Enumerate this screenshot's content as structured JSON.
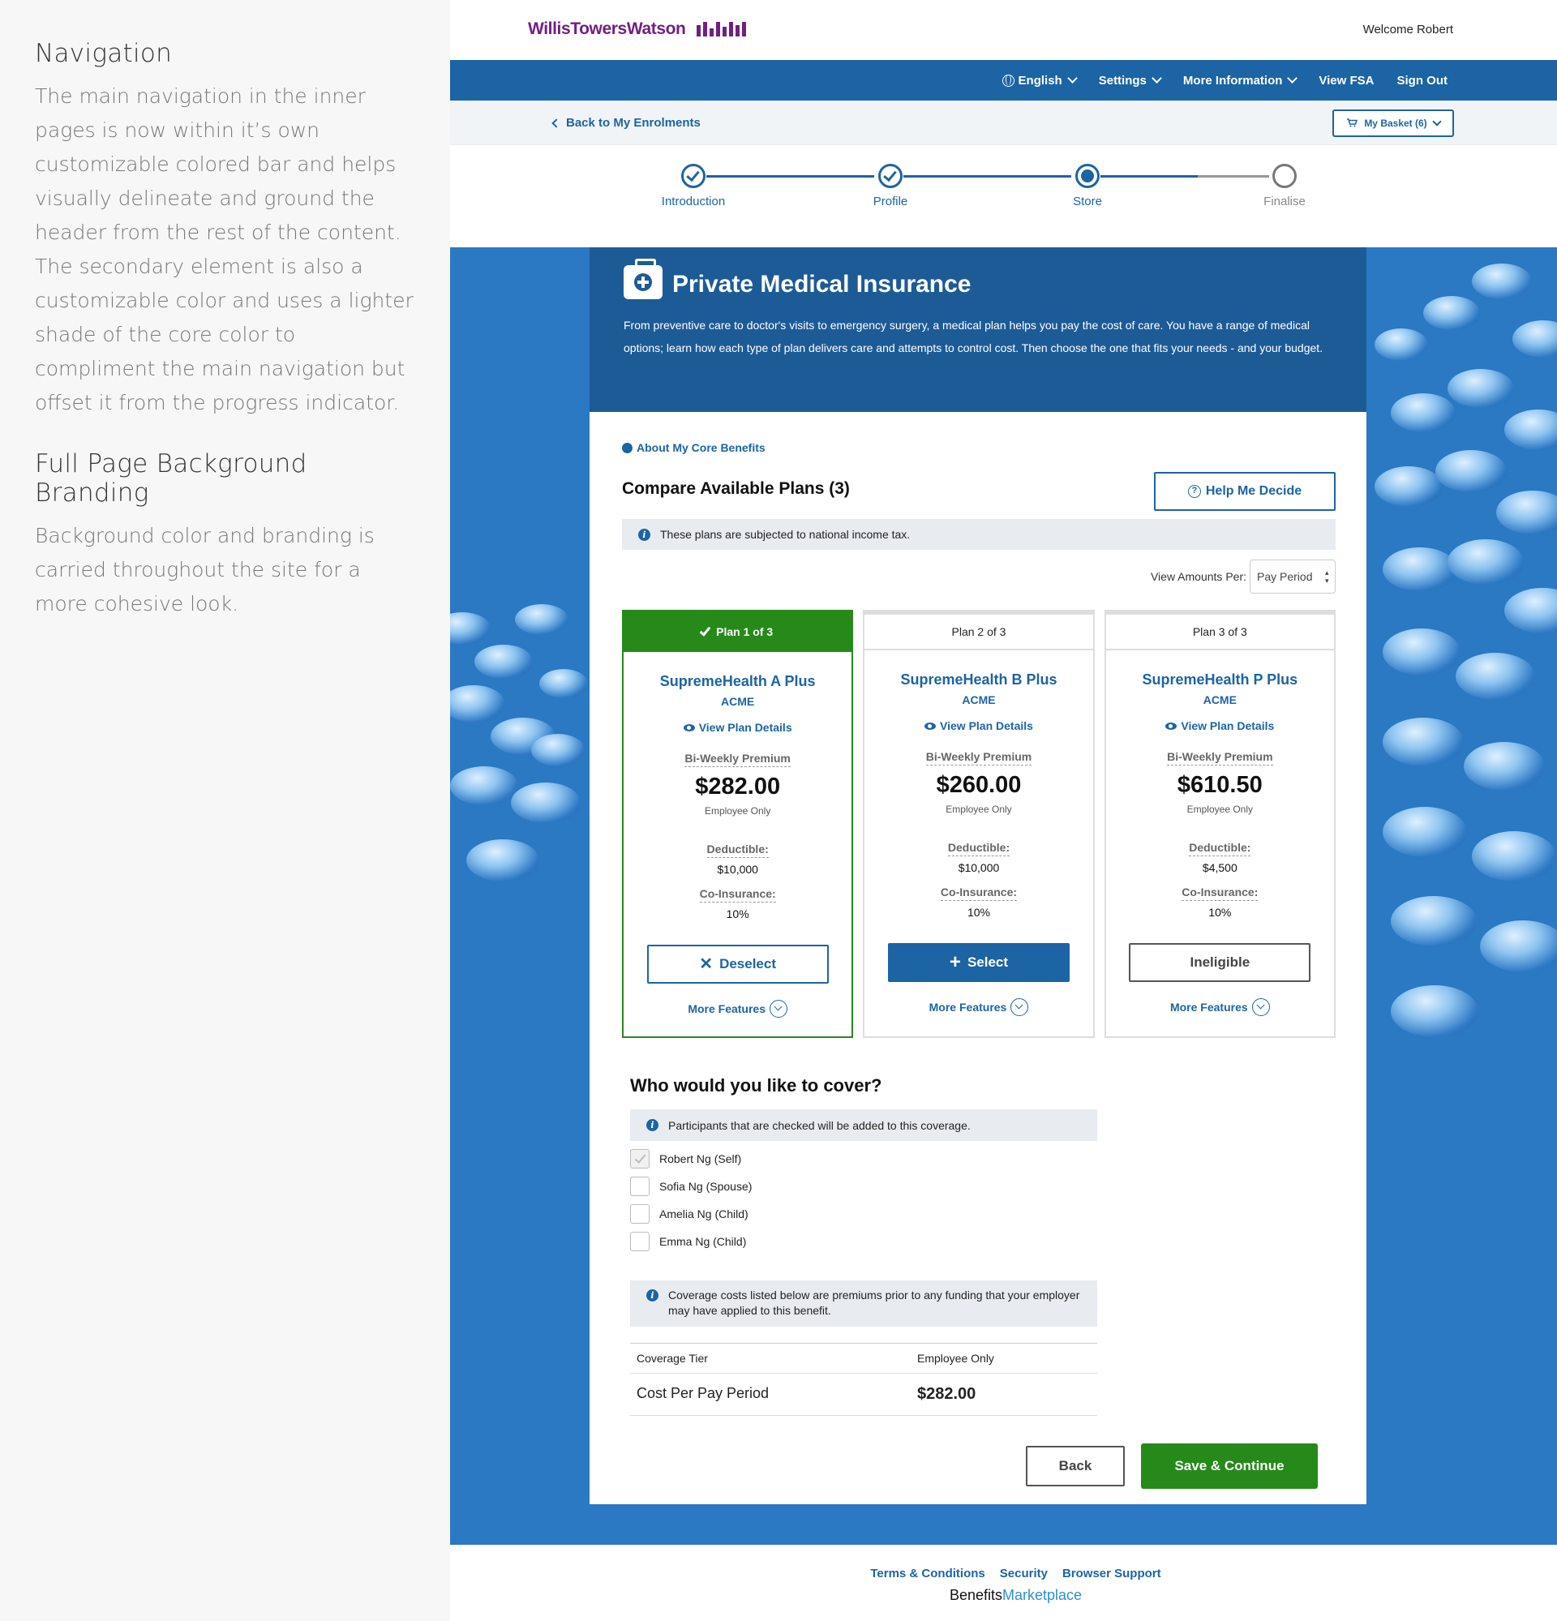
{
  "notes": [
    {
      "title": "Navigation",
      "body": "The main navigation in the inner pages is now within it’s own customizable colored bar and helps visually delineate and ground the header from the rest of the content. The secondary element is also a customizable color and uses a lighter shade of the core color to compliment the main navigation but offset it from the progress indicator."
    },
    {
      "title": "Full Page Background Branding",
      "body": "Background color and branding is carried throughout the site for a more cohesive look."
    }
  ],
  "brand": {
    "logo_text": "WillisTowersWatson",
    "primary_color": "#1c64a3",
    "logo_color": "#702082",
    "success_color": "#268a1a"
  },
  "header": {
    "welcome": "Welcome Robert"
  },
  "nav": {
    "language": "English",
    "settings": "Settings",
    "more_info": "More Information",
    "view_fsa": "View FSA",
    "sign_out": "Sign Out"
  },
  "subbar": {
    "back_link": "Back to My Enrolments",
    "basket": "My Basket (6)"
  },
  "progress": {
    "steps": [
      {
        "label": "Introduction",
        "state": "complete"
      },
      {
        "label": "Profile",
        "state": "complete"
      },
      {
        "label": "Store",
        "state": "current"
      },
      {
        "label": "Finalise",
        "state": "future"
      }
    ]
  },
  "banner": {
    "icon": "medical-kit-icon",
    "title": "Private Medical Insurance",
    "description": "From preventive care to doctor's visits to emergency surgery, a medical plan helps you pay the cost of care. You have a range of medical options; learn how each type of plan delivers care and attempts to control cost. Then choose the one that fits your needs - and your budget."
  },
  "panel": {
    "core_link": "About My Core Benefits",
    "compare_title": "Compare Available Plans (3)",
    "help_button": "Help Me Decide",
    "tax_note": "These plans are subjected to national income tax.",
    "view_amounts_label": "View Amounts Per:",
    "view_amounts_value": "Pay Period"
  },
  "plans": [
    {
      "header": "Plan 1 of 3",
      "name": "SupremeHealth A Plus",
      "carrier": "ACME",
      "details_link": "View Plan Details",
      "premium_label": "Bi-Weekly Premium",
      "premium": "$282.00",
      "coverage": "Employee Only",
      "deductible_label": "Deductible:",
      "deductible": "$10,000",
      "coinsurance_label": "Co-Insurance:",
      "coinsurance": "10%",
      "button": "Deselect",
      "more": "More Features"
    },
    {
      "header": "Plan 2 of 3",
      "name": "SupremeHealth B Plus",
      "carrier": "ACME",
      "details_link": "View Plan Details",
      "premium_label": "Bi-Weekly Premium",
      "premium": "$260.00",
      "coverage": "Employee Only",
      "deductible_label": "Deductible:",
      "deductible": "$10,000",
      "coinsurance_label": "Co-Insurance:",
      "coinsurance": "10%",
      "button": "Select",
      "more": "More Features"
    },
    {
      "header": "Plan 3 of 3",
      "name": "SupremeHealth P Plus",
      "carrier": "ACME",
      "details_link": "View Plan Details",
      "premium_label": "Bi-Weekly Premium",
      "premium": "$610.50",
      "coverage": "Employee Only",
      "deductible_label": "Deductible:",
      "deductible": "$4,500",
      "coinsurance_label": "Co-Insurance:",
      "coinsurance": "10%",
      "button": "Ineligible",
      "more": "More Features"
    }
  ],
  "cover": {
    "title": "Who would you like to cover?",
    "note": "Participants that are checked will be added to this coverage.",
    "people": [
      {
        "name": "Robert Ng (Self)",
        "checked": true
      },
      {
        "name": "Sofia Ng (Spouse)",
        "checked": false
      },
      {
        "name": "Amelia Ng (Child)",
        "checked": false
      },
      {
        "name": "Emma Ng (Child)",
        "checked": false
      }
    ],
    "cost_note": "Coverage costs listed below are premiums prior to any funding that your employer may have applied to this benefit.",
    "table": {
      "tier_label": "Coverage Tier",
      "tier_value": "Employee Only",
      "cost_label": "Cost Per Pay Period",
      "cost_value": "$282.00"
    }
  },
  "actions": {
    "back": "Back",
    "save": "Save & Continue"
  },
  "footer": {
    "links": [
      "Terms & Conditions",
      "Security",
      "Browser Support"
    ],
    "brand_a": "Benefits",
    "brand_b": "Marketplace"
  }
}
